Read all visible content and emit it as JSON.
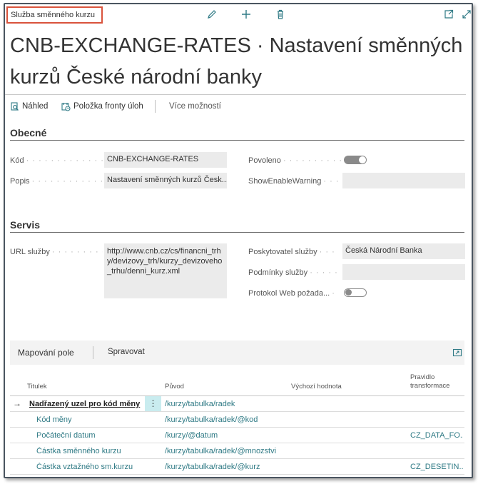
{
  "page": {
    "caption": "Služba směnného kurzu",
    "title": "CNB-EXCHANGE-RATES · Nastavení směnných kurzů České národní banky"
  },
  "icons": {
    "edit": "pencil-icon",
    "new": "plus-icon",
    "delete": "trash-icon",
    "open": "open-new-window-icon",
    "expand": "expand-icon"
  },
  "actions": {
    "preview": "Náhled",
    "job_queue": "Položka fronty úloh",
    "more": "Více možností"
  },
  "general": {
    "header": "Obecné",
    "code_label": "Kód",
    "code_value": "CNB-EXCHANGE-RATES",
    "desc_label": "Popis",
    "desc_value": "Nastavení směnných kurzů Česk...",
    "enabled_label": "Povoleno",
    "enabled_on": true,
    "show_warning_label": "ShowEnableWarning",
    "show_warning_value": ""
  },
  "service": {
    "header": "Servis",
    "url_label": "URL služby",
    "url_line1": "http://www.cnb.cz/cs/financni_trh",
    "url_line2": "y/devizovy_trh/kurzy_devizoveho",
    "url_line3": "_trhu/denni_kurz.xml",
    "provider_label": "Poskytovatel služby",
    "provider_value": "Česká Národní Banka",
    "terms_label": "Podmínky služby",
    "terms_value": "",
    "log_label": "Protokol Web požada...",
    "log_on": false
  },
  "mapping": {
    "tab_label": "Mapování pole",
    "manage_label": "Spravovat",
    "col_title": "Titulek",
    "col_source": "Původ",
    "col_default": "Výchozí hodnota",
    "col_rule_line1": "Pravidlo",
    "col_rule_line2": "transformace",
    "rows": [
      {
        "title": "Nadřazený uzel pro kód měny",
        "source": "/kurzy/tabulka/radek",
        "default": "",
        "rule": ""
      },
      {
        "title": "Kód měny",
        "source": "/kurzy/tabulka/radek/@kod",
        "default": "",
        "rule": ""
      },
      {
        "title": "Počáteční datum",
        "source": "/kurzy/@datum",
        "default": "",
        "rule": "CZ_DATA_FO..."
      },
      {
        "title": "Částka směnného kurzu",
        "source": "/kurzy/tabulka/radek/@mnozstvi",
        "default": "",
        "rule": ""
      },
      {
        "title": "Částka vztažného sm.kurzu",
        "source": "/kurzy/tabulka/radek/@kurz",
        "default": "",
        "rule": "CZ_DESETIN..."
      }
    ]
  },
  "colors": {
    "accent": "#2f7a85",
    "toggle_on": "#8a8a8a",
    "toggle_off_border": "#8a8a8a",
    "highlight": "#d9533c",
    "selected_cell": "#c9ecef"
  }
}
